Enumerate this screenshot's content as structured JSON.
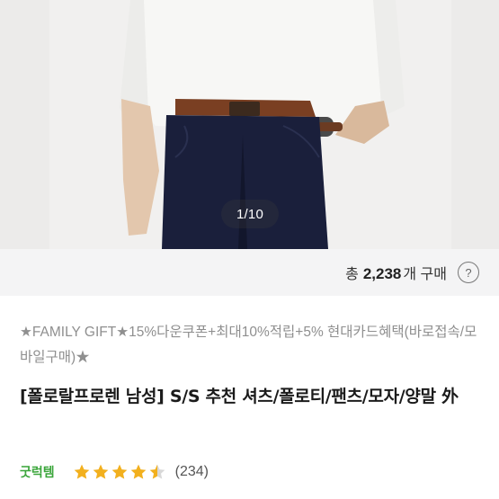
{
  "gallery": {
    "counter": "1/10",
    "colors": {
      "background": "#ecebea",
      "shirt": "#f6f6f4",
      "jeans": "#1a1f3b",
      "belt": "#7a3f22"
    }
  },
  "purchase": {
    "prefix": "총",
    "count": "2,238",
    "suffix": "개 구매",
    "help_icon": "question-mark-icon"
  },
  "promo": {
    "text": "★FAMILY GIFT★15%다운쿠폰+최대10%적립+5% 현대카드혜택(바로접속/모바일구매)★"
  },
  "product": {
    "title": "[폴로랄프로렌 남성] S/S 추천 셔츠/폴로티/팬츠/모자/양말 外"
  },
  "rating": {
    "badge": "굿럭템",
    "stars": 4.5,
    "star_color": "#f2b01e",
    "reviews": "(234)"
  }
}
